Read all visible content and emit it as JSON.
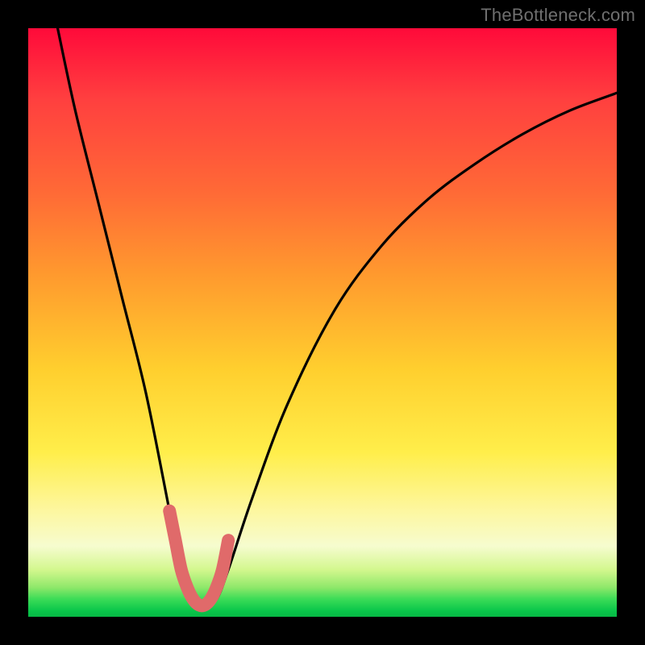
{
  "watermark": "TheBottleneck.com",
  "chart_data": {
    "type": "line",
    "title": "",
    "xlabel": "",
    "ylabel": "",
    "xlim": [
      0,
      100
    ],
    "ylim": [
      0,
      100
    ],
    "series": [
      {
        "name": "bottleneck-curve",
        "x": [
          5,
          8,
          12,
          16,
          20,
          24,
          26,
          28,
          30,
          32,
          34,
          38,
          44,
          52,
          60,
          68,
          76,
          84,
          92,
          100
        ],
        "values": [
          100,
          86,
          70,
          54,
          38,
          18,
          8,
          3,
          2,
          3,
          8,
          20,
          36,
          52,
          63,
          71,
          77,
          82,
          86,
          89
        ]
      }
    ],
    "highlight": {
      "name": "optimal-region",
      "x": [
        24,
        25,
        26,
        27,
        28,
        29,
        30,
        31,
        32,
        33,
        34
      ],
      "values": [
        18,
        13,
        8,
        5,
        3,
        2,
        2,
        3,
        5,
        8,
        13
      ]
    },
    "colors": {
      "curve": "#000000",
      "highlight": "#e06a6a",
      "gradient_top": "#ff0a3a",
      "gradient_bottom": "#07b845"
    }
  }
}
